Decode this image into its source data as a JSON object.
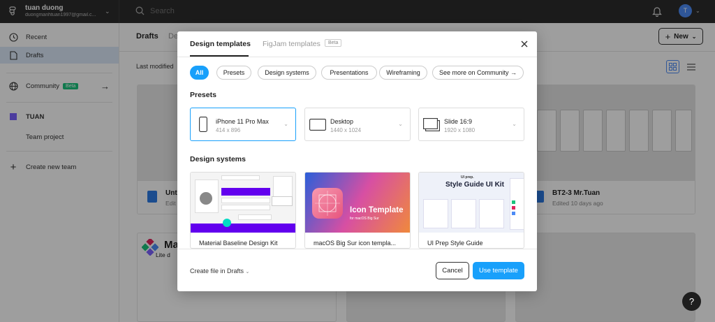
{
  "account": {
    "name": "tuan duong",
    "email": "duongmanhtuan1997@gmail.c..."
  },
  "search": {
    "placeholder": "Search"
  },
  "avatar": {
    "initial": "T"
  },
  "sidebar": {
    "items": [
      {
        "label": "Recent"
      },
      {
        "label": "Drafts"
      },
      {
        "label": "Community",
        "badge": "Beta"
      },
      {
        "label": "TUAN"
      },
      {
        "label": "Team project"
      },
      {
        "label": "Create new team"
      }
    ]
  },
  "main": {
    "tab_drafts": "Drafts",
    "tab_deleted": "De",
    "new_label": "New",
    "sort_label": "Last modified",
    "cards": [
      {
        "title": "Unt",
        "sub": "Edit"
      },
      {
        "title": "BT2-3 Mr.Tuan",
        "sub": "Edited 10 days ago"
      },
      {
        "title": "Ma",
        "sub": "Lite d"
      }
    ]
  },
  "modal": {
    "tab_design": "Design templates",
    "tab_figjam": "FigJam templates",
    "tab_figjam_badge": "Beta",
    "chips": [
      "All",
      "Presets",
      "Design systems",
      "Presentations",
      "Wireframing",
      "See more on Community →"
    ],
    "presets_heading": "Presets",
    "presets": [
      {
        "name": "iPhone 11 Pro Max",
        "size": "414 x 896"
      },
      {
        "name": "Desktop",
        "size": "1440 x 1024"
      },
      {
        "name": "Slide 16:9",
        "size": "1920 x 1080"
      }
    ],
    "ds_heading": "Design systems",
    "templates": [
      {
        "name": "Material Baseline Design Kit"
      },
      {
        "name": "macOS Big Sur icon templa...",
        "img_title": "Icon Template",
        "img_sub": "for macOS Big Sur"
      },
      {
        "name": "UI Prep Style Guide",
        "img_title": "Style Guide UI Kit",
        "img_brand": "UI prep."
      }
    ],
    "create_in": "Create file in Drafts",
    "cancel": "Cancel",
    "use": "Use template"
  },
  "help": "?",
  "colors": {
    "accent": "#18a0fb",
    "topbar": "#2c2c2c",
    "badge_green": "#1bc47d",
    "team": "#7b61ff"
  }
}
